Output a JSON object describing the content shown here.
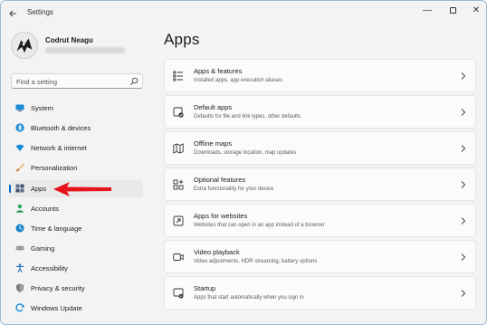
{
  "window": {
    "title": "Settings",
    "back_icon": "back-arrow-icon",
    "controls": {
      "minimize": "—",
      "close": "✕"
    }
  },
  "profile": {
    "name": "Codrut Neagu"
  },
  "search": {
    "placeholder": "Find a setting"
  },
  "nav": {
    "items": [
      {
        "label": "System",
        "icon": "monitor-icon",
        "color": "#0078d4"
      },
      {
        "label": "Bluetooth & devices",
        "icon": "bluetooth-icon",
        "color": "#0078d4"
      },
      {
        "label": "Network & internet",
        "icon": "wifi-icon",
        "color": "#0078d4"
      },
      {
        "label": "Personalization",
        "icon": "brush-icon",
        "color": "#e8912d"
      },
      {
        "label": "Apps",
        "icon": "apps-icon",
        "color": "#4a5c7a",
        "active": true
      },
      {
        "label": "Accounts",
        "icon": "person-icon",
        "color": "#2fae6b"
      },
      {
        "label": "Time & language",
        "icon": "globe-clock-icon",
        "color": "#1a89c9"
      },
      {
        "label": "Gaming",
        "icon": "gamepad-icon",
        "color": "#7a7a7a"
      },
      {
        "label": "Accessibility",
        "icon": "accessibility-icon",
        "color": "#1a6fc4"
      },
      {
        "label": "Privacy & security",
        "icon": "shield-icon",
        "color": "#6b6b6b"
      },
      {
        "label": "Windows Update",
        "icon": "update-icon",
        "color": "#0078d4"
      }
    ],
    "accent": "#0067c0"
  },
  "annotation": {
    "arrow_color": "#e8141b"
  },
  "main": {
    "title": "Apps",
    "cards": [
      {
        "title": "Apps & features",
        "subtitle": "Installed apps, app execution aliases",
        "icon": "apps-list-icon"
      },
      {
        "title": "Default apps",
        "subtitle": "Defaults for file and link types, other defaults",
        "icon": "default-apps-icon"
      },
      {
        "title": "Offline maps",
        "subtitle": "Downloads, storage location, map updates",
        "icon": "map-icon"
      },
      {
        "title": "Optional features",
        "subtitle": "Extra functionality for your device",
        "icon": "optional-features-icon"
      },
      {
        "title": "Apps for websites",
        "subtitle": "Websites that can open in an app instead of a browser",
        "icon": "web-apps-icon"
      },
      {
        "title": "Video playback",
        "subtitle": "Video adjustments, HDR streaming, battery options",
        "icon": "video-icon"
      },
      {
        "title": "Startup",
        "subtitle": "Apps that start automatically when you sign in",
        "icon": "startup-icon"
      }
    ]
  }
}
